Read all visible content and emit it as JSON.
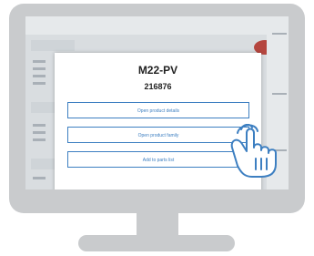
{
  "dialog": {
    "title": "M22-PV",
    "code": "216876",
    "actions": [
      {
        "label": "Open product details"
      },
      {
        "label": "Open product family"
      },
      {
        "label": "Add to parts list"
      }
    ]
  },
  "colors": {
    "monitor": "#c9cbcd",
    "accent": "#3d7fc1",
    "hand": "#ffffff"
  },
  "icons": {
    "pointer": "pointing-hand-icon"
  }
}
